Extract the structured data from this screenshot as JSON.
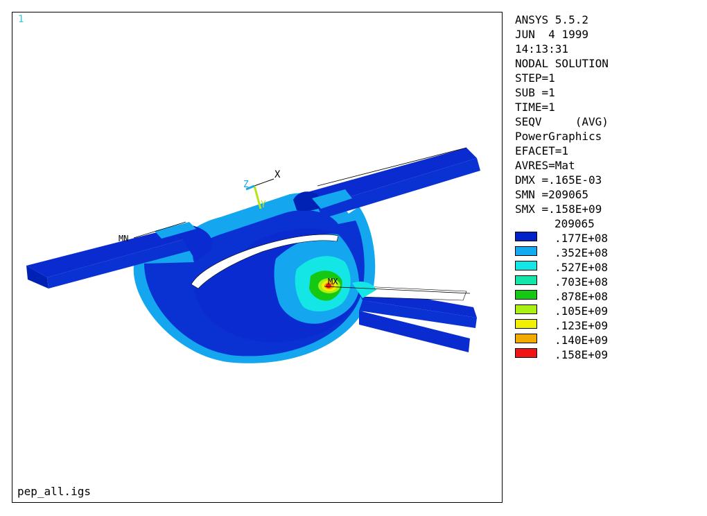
{
  "viewport": {
    "window_number": "1",
    "filename": "pep_all.igs",
    "triad": {
      "x_label": "X",
      "y_label": "Y",
      "z_label": "Z"
    },
    "markers": {
      "mx_label": "MX",
      "mn_label": "MN"
    }
  },
  "info": {
    "lines": [
      "ANSYS 5.5.2",
      "JUN  4 1999",
      "14:13:31",
      "NODAL SOLUTION",
      "STEP=1",
      "SUB =1",
      "TIME=1",
      "SEQV     (AVG)",
      "PowerGraphics",
      "EFACET=1",
      "AVRES=Mat",
      "DMX =.165E-03",
      "SMN =209065",
      "SMX =.158E+09"
    ]
  },
  "legend": {
    "min_label": "209065",
    "entries": [
      {
        "label": ".177E+08",
        "color": "#0022c8"
      },
      {
        "label": ".352E+08",
        "color": "#14aaf0"
      },
      {
        "label": ".527E+08",
        "color": "#14e6e6"
      },
      {
        "label": ".703E+08",
        "color": "#14e6aa"
      },
      {
        "label": ".878E+08",
        "color": "#14c814"
      },
      {
        "label": ".105E+09",
        "color": "#aaf014"
      },
      {
        "label": ".123E+09",
        "color": "#f0f000"
      },
      {
        "label": ".140E+09",
        "color": "#f0aa00"
      },
      {
        "label": ".158E+09",
        "color": "#f01414"
      }
    ]
  }
}
